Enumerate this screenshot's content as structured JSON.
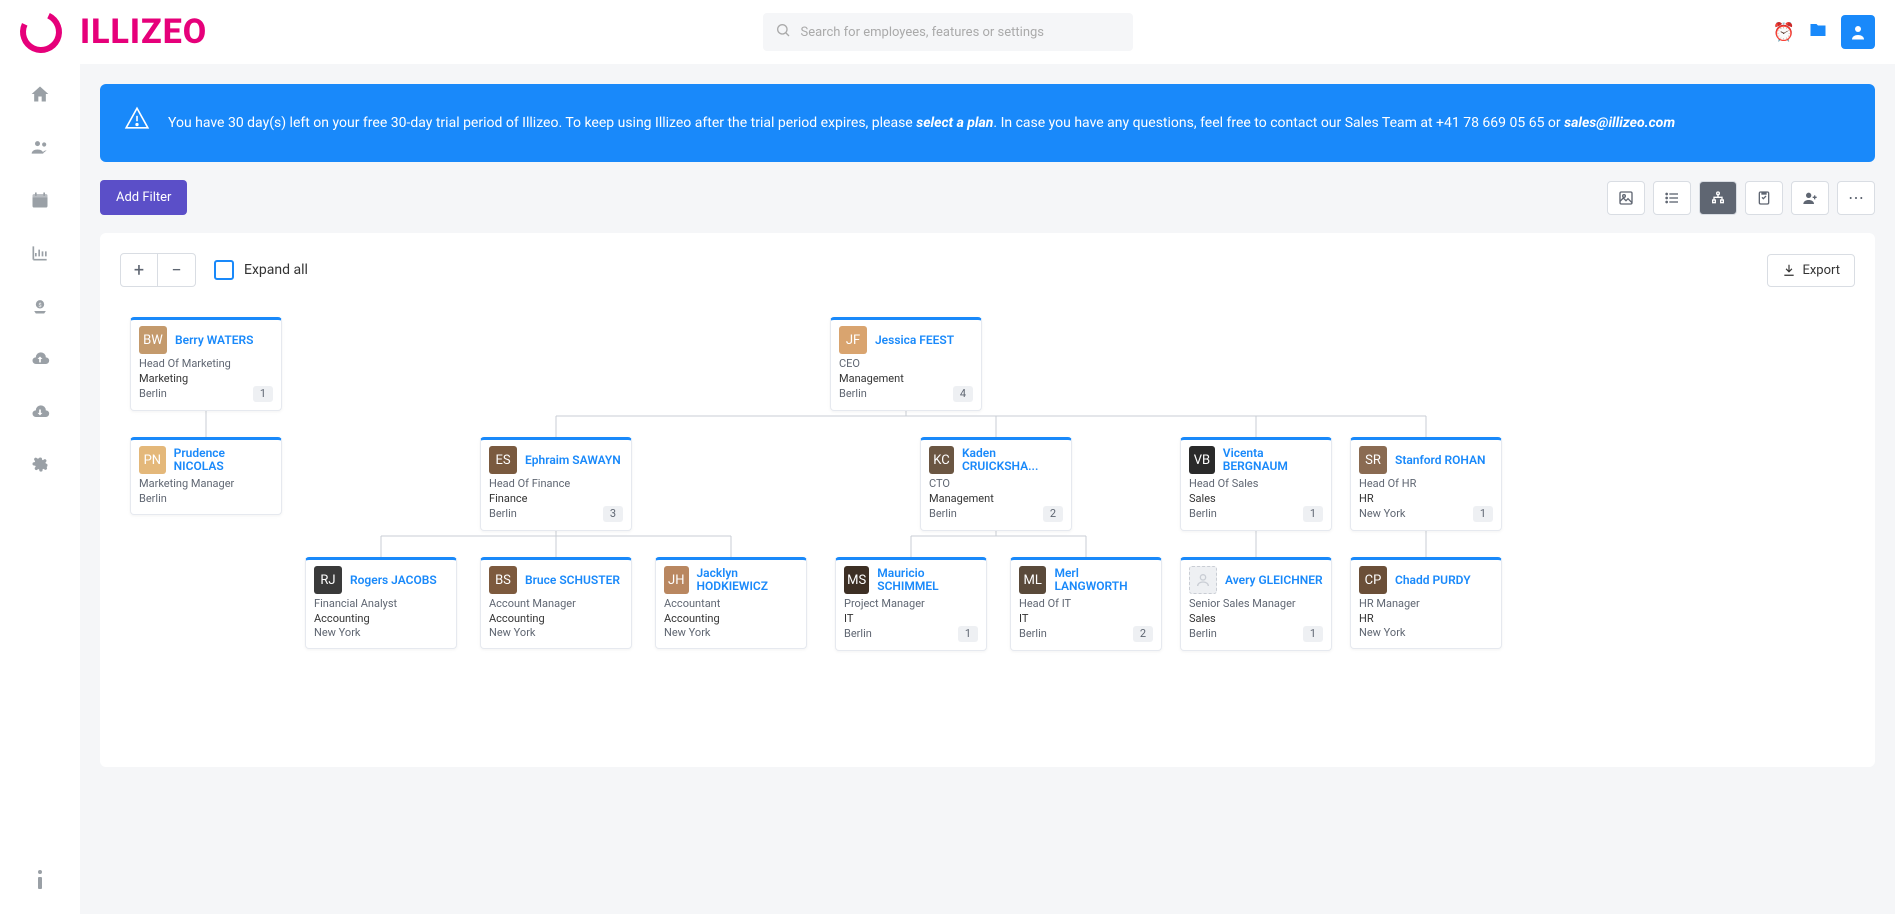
{
  "brand": "ILLIZEO",
  "search_placeholder": "Search for employees, features or settings",
  "banner": {
    "prefix": "You have 30 day(s) left on your free 30-day trial period of Illizeo. To keep using Illizeo after the trial period expires, please ",
    "select": "select a plan",
    "mid": ". In case you have any questions, feel free to contact our Sales Team at +41 78 669 05 65 or ",
    "email": "sales@illizeo.com"
  },
  "add_filter": "Add Filter",
  "expand_all": "Expand all",
  "export": "Export",
  "nodes": {
    "berry": {
      "name": "Berry WATERS",
      "title": "Head Of Marketing",
      "dept": "Marketing",
      "loc": "Berlin",
      "count": "1",
      "color": "#c49a6c"
    },
    "jessica": {
      "name": "Jessica FEEST",
      "title": "CEO",
      "dept": "Management",
      "loc": "Berlin",
      "count": "4",
      "color": "#d9a46f"
    },
    "prudence": {
      "name": "Prudence NICOLAS",
      "title": "Marketing Manager",
      "dept": "",
      "loc": "Berlin",
      "color": "#e4b87a"
    },
    "ephraim": {
      "name": "Ephraim SAWAYN",
      "title": "Head Of Finance",
      "dept": "Finance",
      "loc": "Berlin",
      "count": "3",
      "color": "#7a5a3f"
    },
    "kaden": {
      "name": "Kaden CRUICKSHA...",
      "title": "CTO",
      "dept": "Management",
      "loc": "Berlin",
      "count": "2",
      "color": "#6b5642"
    },
    "vicenta": {
      "name": "Vicenta BERGNAUM",
      "title": "Head Of Sales",
      "dept": "Sales",
      "loc": "Berlin",
      "count": "1",
      "color": "#2a2a2a"
    },
    "stanford": {
      "name": "Stanford ROHAN",
      "title": "Head Of HR",
      "dept": "HR",
      "loc": "New York",
      "count": "1",
      "color": "#8a6b52"
    },
    "rogers": {
      "name": "Rogers JACOBS",
      "title": "Financial Analyst",
      "dept": "Accounting",
      "loc": "New York",
      "color": "#3a3a3a"
    },
    "bruce": {
      "name": "Bruce SCHUSTER",
      "title": "Account Manager",
      "dept": "Accounting",
      "loc": "New York",
      "color": "#7d5a3e"
    },
    "jacklyn": {
      "name": "Jacklyn HODKIEWICZ",
      "title": "Accountant",
      "dept": "Accounting",
      "loc": "New York",
      "color": "#b98760"
    },
    "mauricio": {
      "name": "Mauricio SCHIMMEL",
      "title": "Project Manager",
      "dept": "IT",
      "loc": "Berlin",
      "count": "1",
      "color": "#3d2f24"
    },
    "merl": {
      "name": "Merl LANGWORTH",
      "title": "Head Of IT",
      "dept": "IT",
      "loc": "Berlin",
      "count": "2",
      "color": "#5a4a3a"
    },
    "avery": {
      "name": "Avery GLEICHNER",
      "title": "Senior Sales Manager",
      "dept": "Sales",
      "loc": "Berlin",
      "count": "1",
      "placeholder": true
    },
    "chadd": {
      "name": "Chadd PURDY",
      "title": "HR Manager",
      "dept": "HR",
      "loc": "New York",
      "color": "#6b4f38"
    }
  }
}
